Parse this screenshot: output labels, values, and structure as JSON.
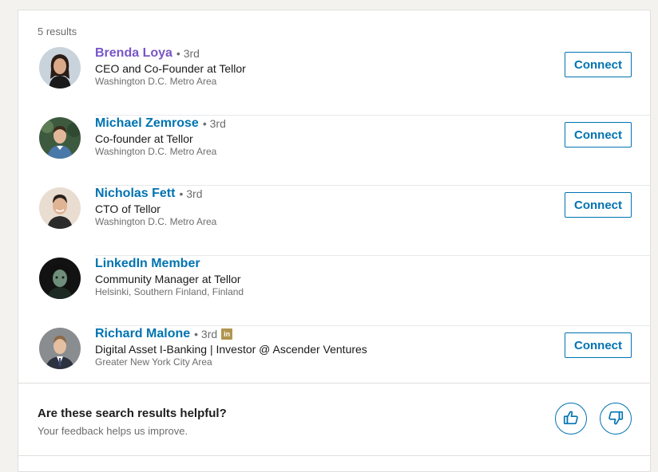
{
  "results_count": "5 results",
  "results": [
    {
      "name": "Brenda Loya",
      "degree": "• 3rd",
      "headline": "CEO and Co-Founder at Tellor",
      "location": "Washington D.C. Metro Area",
      "connect_label": "Connect",
      "visited": true,
      "premium": false,
      "avatar": {
        "bg": "#c9d3dc",
        "skin": "#d9a98a",
        "hair": "#2a1d16",
        "shirt": "#1a1a1a"
      }
    },
    {
      "name": "Michael Zemrose",
      "degree": "• 3rd",
      "headline": "Co-founder at Tellor",
      "location": "Washington D.C. Metro Area",
      "connect_label": "Connect",
      "visited": false,
      "premium": false,
      "avatar": {
        "bg": "#3d5a3e",
        "skin": "#e2b89a",
        "hair": "#3a2a1c",
        "shirt": "#4a78a8"
      }
    },
    {
      "name": "Nicholas Fett",
      "degree": "• 3rd",
      "headline": "CTO of Tellor",
      "location": "Washington D.C. Metro Area",
      "connect_label": "Connect",
      "visited": false,
      "premium": false,
      "avatar": {
        "bg": "#e8ddd0",
        "skin": "#e0b394",
        "hair": "#2b201a",
        "shirt": "#2b2b2b"
      }
    },
    {
      "name": "LinkedIn Member",
      "degree": "",
      "headline": "Community Manager at Tellor",
      "location": "Helsinki, Southern Finland, Finland",
      "connect_label": "",
      "visited": false,
      "premium": false,
      "avatar": {
        "bg": "#121212",
        "skin": "#6e8e7a",
        "hair": "#101010",
        "shirt": "#1e2a24"
      }
    },
    {
      "name": "Richard Malone",
      "degree": "• 3rd",
      "headline": "Digital Asset I-Banking | Investor @ Ascender Ventures",
      "location": "Greater New York City Area",
      "connect_label": "Connect",
      "visited": false,
      "premium": true,
      "avatar": {
        "bg": "#8a8d90",
        "skin": "#e4bfa2",
        "hair": "#8b6a48",
        "shirt": "#2c3240"
      }
    }
  ],
  "premium_badge": "in",
  "feedback": {
    "title": "Are these search results helpful?",
    "subtitle": "Your feedback helps us improve.",
    "up_icon": "thumbs-up-icon",
    "down_icon": "thumbs-down-icon"
  },
  "colors": {
    "link_blue": "#0073b1",
    "visited_purple": "#7855c8",
    "premium_gold": "#b1954e"
  }
}
